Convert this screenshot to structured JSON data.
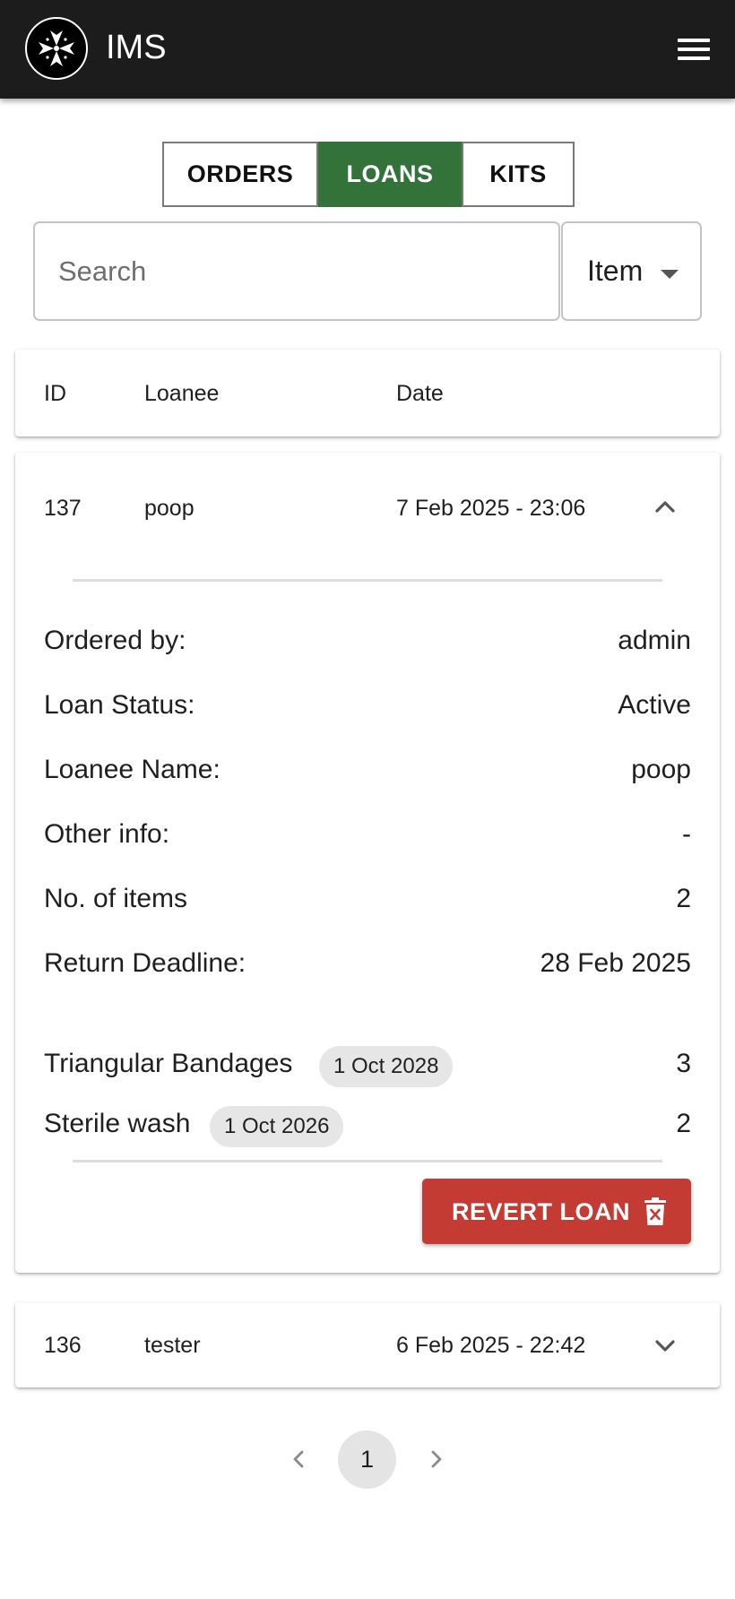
{
  "app": {
    "title": "IMS",
    "logo_icon": "maltese-cross-logo",
    "menu_icon": "hamburger-menu-icon"
  },
  "colors": {
    "appbar": "#1c1c1c",
    "active_tab": "#33733a",
    "danger": "#c43b33",
    "chip": "#e6e6e6"
  },
  "tabs": [
    {
      "label": "ORDERS",
      "active": false
    },
    {
      "label": "LOANS",
      "active": true
    },
    {
      "label": "KITS",
      "active": false
    }
  ],
  "search": {
    "placeholder": "Search",
    "value": "",
    "filter_selected": "Item",
    "filter_icon": "caret-down-icon"
  },
  "table": {
    "headers": {
      "id": "ID",
      "loanee": "Loanee",
      "date": "Date"
    },
    "rows": [
      {
        "id": "137",
        "loanee": "poop",
        "date": "7 Feb 2025 - 23:06",
        "expanded": true,
        "toggle_icon": "chevron-up-icon",
        "details": [
          {
            "label": "Ordered by:",
            "value": "admin"
          },
          {
            "label": "Loan Status:",
            "value": "Active"
          },
          {
            "label": "Loanee Name:",
            "value": "poop"
          },
          {
            "label": "Other info:",
            "value": "-"
          },
          {
            "label": "No. of items",
            "value": "2"
          },
          {
            "label": "Return Deadline:",
            "value": "28 Feb 2025"
          }
        ],
        "items": [
          {
            "name": "Triangular Bandages",
            "expiry": "1 Oct 2028",
            "qty": "3"
          },
          {
            "name": "Sterile wash",
            "expiry": "1 Oct 2026",
            "qty": "2"
          }
        ],
        "action": {
          "label": "REVERT LOAN",
          "icon": "trash-x-icon"
        }
      },
      {
        "id": "136",
        "loanee": "tester",
        "date": "6 Feb 2025 - 22:42",
        "expanded": false,
        "toggle_icon": "chevron-down-icon"
      }
    ]
  },
  "pagination": {
    "current_page": "1",
    "prev_icon": "chevron-left-icon",
    "next_icon": "chevron-right-icon"
  }
}
